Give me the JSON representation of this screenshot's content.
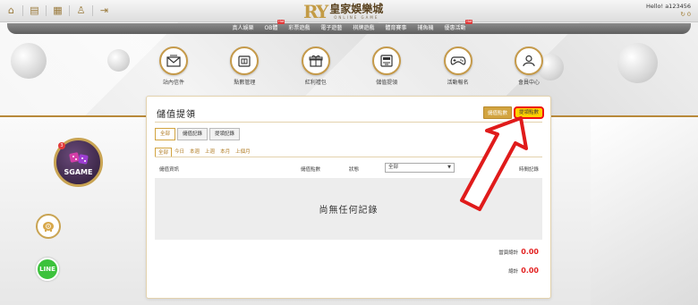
{
  "header": {
    "logo_mark": "RY",
    "logo_title": "皇家娛樂城",
    "logo_subtitle": "ONLINE GAME",
    "greeting": "Hello! a123456",
    "balance": "0",
    "top_icons": [
      "home-icon",
      "notice-icon",
      "gift-icon",
      "user-icon",
      "logout-icon"
    ]
  },
  "menu": {
    "items": [
      {
        "label": "真人娛樂",
        "hot": ""
      },
      {
        "label": "OB體",
        "hot": "Hot"
      },
      {
        "label": "彩票遊戲",
        "hot": ""
      },
      {
        "label": "電子遊藝",
        "hot": ""
      },
      {
        "label": "棋牌遊戲",
        "hot": ""
      },
      {
        "label": "體育賽事",
        "hot": ""
      },
      {
        "label": "捕魚機",
        "hot": ""
      },
      {
        "label": "優惠活動",
        "hot": "Hot"
      }
    ]
  },
  "quick_links": [
    {
      "label": "站內信件",
      "icon": "mail-icon"
    },
    {
      "label": "點數管理",
      "icon": "wallet-icon"
    },
    {
      "label": "紅利禮包",
      "icon": "gift-box-icon"
    },
    {
      "label": "儲值提領",
      "icon": "atm-icon"
    },
    {
      "label": "活動報名",
      "icon": "gamepad-icon"
    },
    {
      "label": "會員中心",
      "icon": "member-icon"
    }
  ],
  "side": {
    "sgame_badge": "3",
    "sgame_label": "SGAME",
    "line_label": "LINE"
  },
  "panel": {
    "title": "儲值提領",
    "deposit_points_btn": "儲值點數",
    "withdraw_points_btn": "提領點數",
    "tabs": [
      "全部",
      "儲值記錄",
      "提領記錄"
    ],
    "ranges": [
      "全部",
      "今日",
      "本週",
      "上週",
      "本月",
      "上個月"
    ],
    "columns": {
      "info": "儲值資訊",
      "points": "儲值點數",
      "status": "狀態",
      "filter_value": "全部",
      "time": "時間記錄"
    },
    "empty_text": "尚無任何記錄",
    "page_total_label": "當頁總計",
    "page_total_value": "0.00",
    "total_label": "總計",
    "total_value": "0.00"
  }
}
